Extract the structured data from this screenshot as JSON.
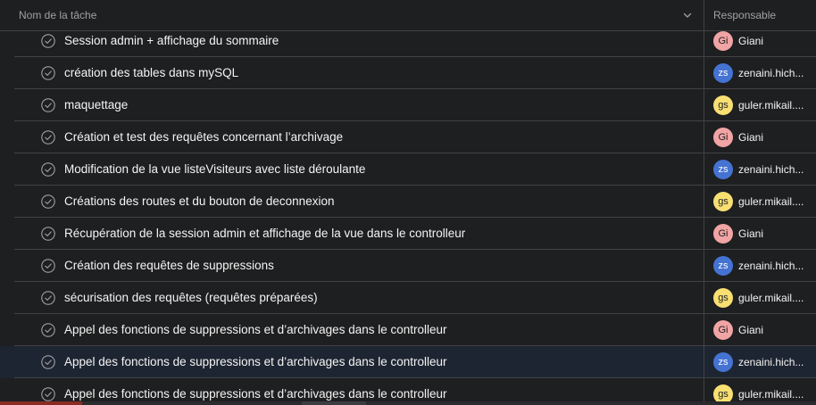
{
  "header": {
    "task_column": "Nom de la tâche",
    "assignee_column": "Responsable",
    "sort_icon": "chevron-down-icon"
  },
  "colors": {
    "background": "#1e1f21",
    "selected_row": "#1d2532",
    "border": "#424244",
    "avatar_gi": "#f1a4a4",
    "avatar_zs": "#4573d2",
    "avatar_gs": "#f8df72"
  },
  "rows": [
    {
      "task": "Session admin + affichage du sommaire",
      "initials": "Gi",
      "assignee": "Giani",
      "avatar_color": "#f1a4a4",
      "avatar_text": "#1e1f21",
      "selected": false
    },
    {
      "task": "création des tables dans mySQL",
      "initials": "zs",
      "assignee": "zenaini.hich...",
      "avatar_color": "#4573d2",
      "avatar_text": "#ffffff",
      "selected": false
    },
    {
      "task": "maquettage",
      "initials": "gs",
      "assignee": "guler.mikail....",
      "avatar_color": "#f8df72",
      "avatar_text": "#1e1f21",
      "selected": false
    },
    {
      "task": "Création et test des requêtes concernant l’archivage",
      "initials": "Gi",
      "assignee": "Giani",
      "avatar_color": "#f1a4a4",
      "avatar_text": "#1e1f21",
      "selected": false
    },
    {
      "task": "Modification de la vue listeVisiteurs avec liste déroulante",
      "initials": "zs",
      "assignee": "zenaini.hich...",
      "avatar_color": "#4573d2",
      "avatar_text": "#ffffff",
      "selected": false
    },
    {
      "task": "Créations des routes et du bouton de deconnexion",
      "initials": "gs",
      "assignee": "guler.mikail....",
      "avatar_color": "#f8df72",
      "avatar_text": "#1e1f21",
      "selected": false
    },
    {
      "task": "Récupération de la session admin et affichage de la vue dans le controlleur",
      "initials": "Gi",
      "assignee": "Giani",
      "avatar_color": "#f1a4a4",
      "avatar_text": "#1e1f21",
      "selected": false
    },
    {
      "task": "Création des requêtes de suppressions",
      "initials": "zs",
      "assignee": "zenaini.hich...",
      "avatar_color": "#4573d2",
      "avatar_text": "#ffffff",
      "selected": false
    },
    {
      "task": "sécurisation des requêtes (requêtes préparées)",
      "initials": "gs",
      "assignee": "guler.mikail....",
      "avatar_color": "#f8df72",
      "avatar_text": "#1e1f21",
      "selected": false
    },
    {
      "task": "Appel des fonctions de suppressions et d’archivages dans le controlleur",
      "initials": "Gi",
      "assignee": "Giani",
      "avatar_color": "#f1a4a4",
      "avatar_text": "#1e1f21",
      "selected": false
    },
    {
      "task": "Appel des fonctions de suppressions et d’archivages dans le controlleur",
      "initials": "zs",
      "assignee": "zenaini.hich...",
      "avatar_color": "#4573d2",
      "avatar_text": "#ffffff",
      "selected": true
    },
    {
      "task": "Appel des fonctions de suppressions et d’archivages dans le controlleur",
      "initials": "gs",
      "assignee": "guler.mikail....",
      "avatar_color": "#f8df72",
      "avatar_text": "#1e1f21",
      "selected": false
    }
  ]
}
